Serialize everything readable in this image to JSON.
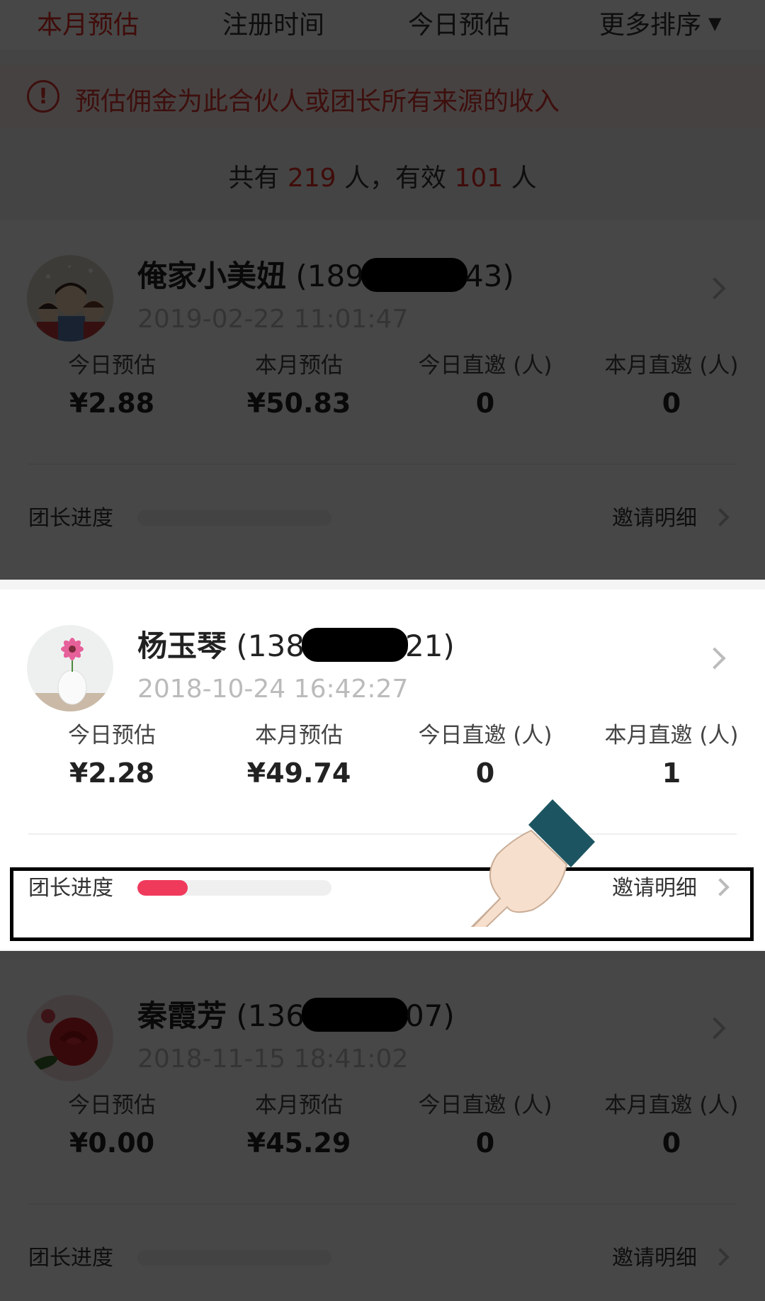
{
  "sort_tabs": [
    {
      "label": "本月预估",
      "active": true
    },
    {
      "label": "注册时间",
      "active": false
    },
    {
      "label": "今日预估",
      "active": false
    },
    {
      "label": "更多排序",
      "active": false
    }
  ],
  "notice": {
    "icon": "exclamation-circle-icon",
    "text": "预估佣金为此合伙人或团长所有来源的收入"
  },
  "summary": {
    "prefix": "共有",
    "total": "219",
    "mid": "人，有效",
    "valid": "101",
    "suffix": "人"
  },
  "stat_labels": [
    "今日预估",
    "本月预估",
    "今日直邀 (人)",
    "本月直邀 (人)"
  ],
  "progress_label": "团长进度",
  "invite_label": "邀请明细",
  "members": [
    {
      "name": "俺家小美妞",
      "phone_prefix": "(189",
      "phone_suffix": "43)",
      "reg_time": "2019-02-22 11:01:47",
      "stats": [
        "¥2.88",
        "¥50.83",
        "0",
        "0"
      ],
      "progress": 0,
      "avatar": "cartoon-family-avatar"
    },
    {
      "name": "杨玉琴",
      "phone_prefix": "(138",
      "phone_suffix": "21)",
      "reg_time": "2018-10-24 16:42:27",
      "stats": [
        "¥2.28",
        "¥49.74",
        "0",
        "1"
      ],
      "progress": 0.26,
      "avatar": "pink-flower-vase-avatar"
    },
    {
      "name": "秦霞芳",
      "phone_prefix": "(136",
      "phone_suffix": "07)",
      "reg_time": "2018-11-15 18:41:02",
      "stats": [
        "¥0.00",
        "¥45.29",
        "0",
        "0"
      ],
      "progress": 0,
      "avatar": "red-rose-avatar"
    }
  ],
  "colors": {
    "accent": "#e02e24",
    "progress_fill": "#f03a5c",
    "notice_bg": "#fdeceb"
  }
}
